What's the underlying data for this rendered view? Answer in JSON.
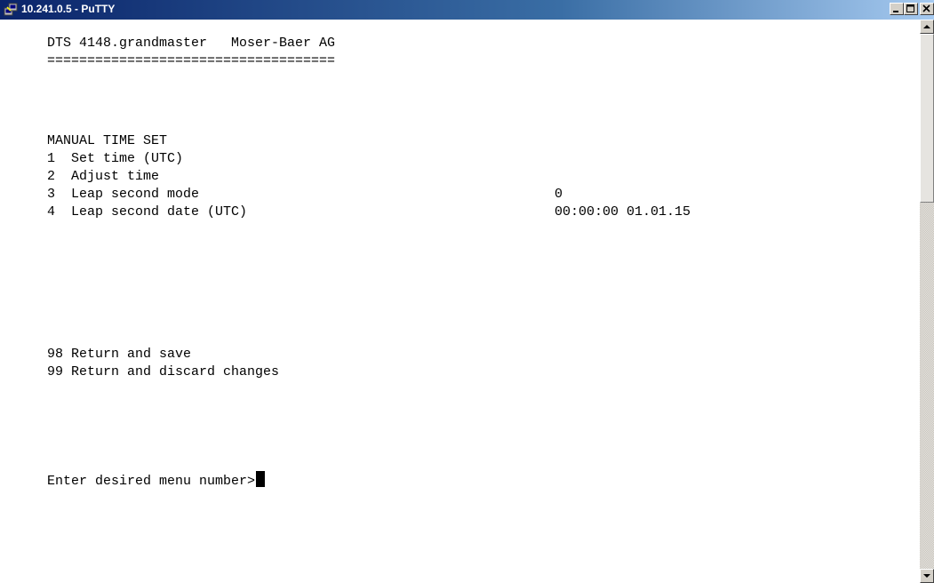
{
  "window": {
    "title": "10.241.0.5 - PuTTY",
    "buttons": {
      "minimize": "minimize-icon",
      "maximize": "maximize-icon",
      "close": "close-icon"
    }
  },
  "colors": {
    "titlebar_start": "#0a246a",
    "titlebar_end": "#a6caf0",
    "terminal_bg": "#ffffff",
    "terminal_fg": "#000000"
  },
  "terminal": {
    "header": "DTS 4148.grandmaster   Moser-Baer AG",
    "separator": "====================================",
    "section_title": "MANUAL TIME SET",
    "menu_items": [
      {
        "label": "1  Set time (UTC)",
        "value": ""
      },
      {
        "label": "2  Adjust time",
        "value": ""
      },
      {
        "label": "3  Leap second mode",
        "value": "0"
      },
      {
        "label": "4  Leap second date (UTC)",
        "value": "00:00:00 01.01.15"
      }
    ],
    "return_items": [
      "98 Return and save",
      "99 Return and discard changes"
    ],
    "prompt": "Enter desired menu number>"
  }
}
